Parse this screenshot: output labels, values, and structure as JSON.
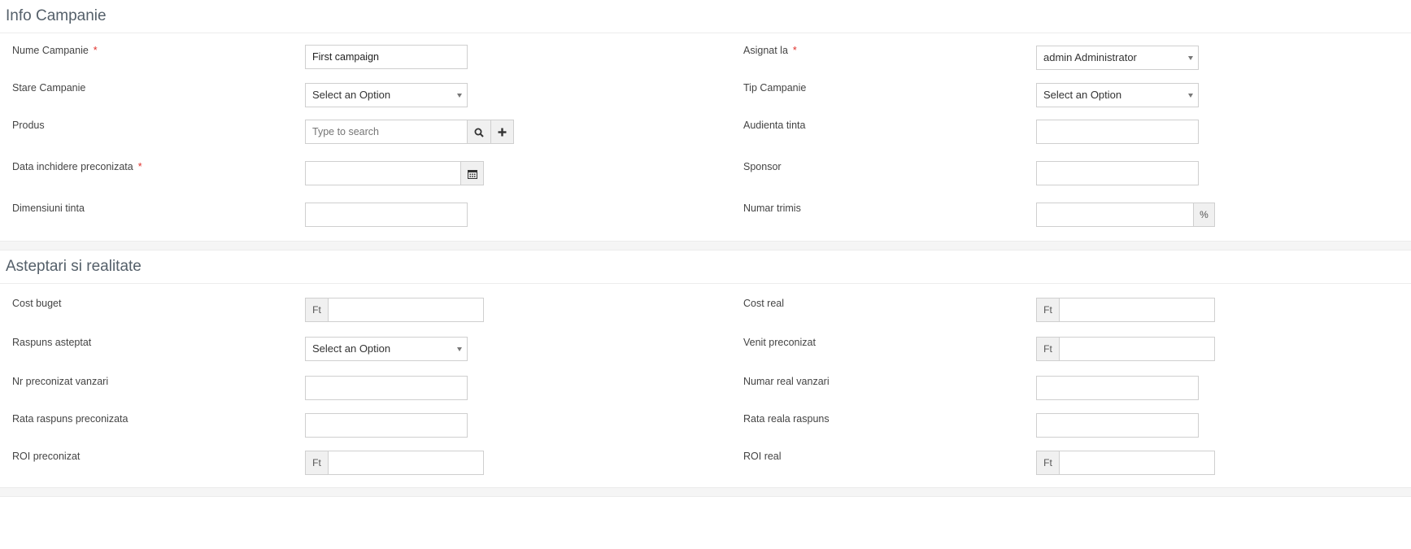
{
  "sections": {
    "info": {
      "title": "Info Campanie",
      "fields": {
        "campaign_name": {
          "label": "Nume Campanie",
          "required": "*",
          "value": "First campaign"
        },
        "assigned_to": {
          "label": "Asignat la",
          "required": "*",
          "value": "admin Administrator"
        },
        "campaign_status": {
          "label": "Stare Campanie",
          "value": "Select an Option"
        },
        "campaign_type": {
          "label": "Tip Campanie",
          "value": "Select an Option"
        },
        "product": {
          "label": "Produs",
          "placeholder": "Type to search"
        },
        "target_audience": {
          "label": "Audienta tinta",
          "value": ""
        },
        "expected_close_date": {
          "label": "Data inchidere preconizata",
          "required": "*",
          "value": ""
        },
        "sponsor": {
          "label": "Sponsor",
          "value": ""
        },
        "target_size": {
          "label": "Dimensiuni tinta",
          "value": ""
        },
        "num_sent": {
          "label": "Numar trimis",
          "value": "",
          "addon": "%"
        }
      }
    },
    "expectations": {
      "title": "Asteptari si realitate",
      "fields": {
        "budget_cost": {
          "label": "Cost buget",
          "currency": "Ft",
          "value": ""
        },
        "actual_cost": {
          "label": "Cost real",
          "currency": "Ft",
          "value": ""
        },
        "expected_response": {
          "label": "Raspuns asteptat",
          "value": "Select an Option"
        },
        "expected_revenue": {
          "label": "Venit preconizat",
          "currency": "Ft",
          "value": ""
        },
        "expected_sales_count": {
          "label": "Nr preconizat vanzari",
          "value": ""
        },
        "actual_sales_count": {
          "label": "Numar real vanzari",
          "value": ""
        },
        "expected_response_rate": {
          "label": "Rata raspuns preconizata",
          "value": ""
        },
        "actual_response_rate": {
          "label": "Rata reala raspuns",
          "value": ""
        },
        "expected_roi": {
          "label": "ROI preconizat",
          "currency": "Ft",
          "value": ""
        },
        "actual_roi": {
          "label": "ROI real",
          "currency": "Ft",
          "value": ""
        }
      }
    }
  },
  "icons": {
    "search": "search-icon",
    "add": "plus-icon",
    "calendar": "calendar-icon",
    "dropdown": "caret-down-icon"
  },
  "colors": {
    "required": "#e0312b",
    "title": "#55606a",
    "border": "#cfcfcf",
    "addon_bg": "#f0f0f0"
  }
}
